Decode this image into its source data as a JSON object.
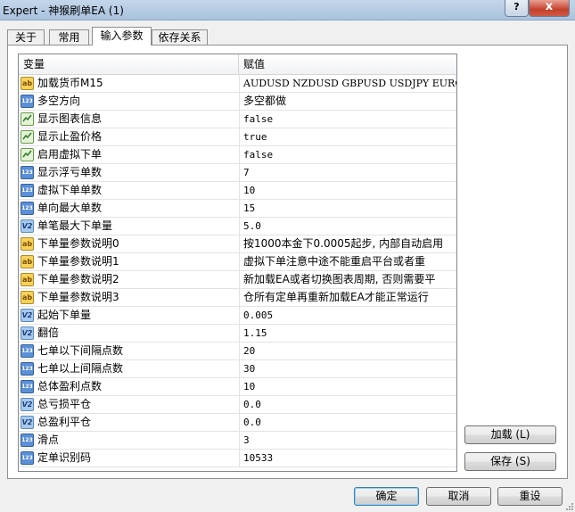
{
  "window": {
    "title": "Expert - 神猴刷单EA (1)",
    "help_label": "?",
    "close_label": "x"
  },
  "tabs": [
    {
      "label": "关于",
      "active": false
    },
    {
      "label": "常用",
      "active": false
    },
    {
      "label": "输入参数",
      "active": true
    },
    {
      "label": "依存关系",
      "active": false
    }
  ],
  "grid": {
    "columns": [
      "变量",
      "赋值"
    ],
    "rows": [
      {
        "type": "ab",
        "icon_name": "string-type-icon",
        "name": "加载货币M15",
        "value": "AUDUSD NZDUSD GBPUSD USDJPY EURGBP G..."
      },
      {
        "type": "123",
        "icon_name": "integer-type-icon",
        "name": "多空方向",
        "value": "多空都做"
      },
      {
        "type": "bool",
        "icon_name": "bool-type-icon",
        "name": "显示图表信息",
        "value": "false"
      },
      {
        "type": "bool",
        "icon_name": "bool-type-icon",
        "name": "显示止盈价格",
        "value": "true"
      },
      {
        "type": "bool",
        "icon_name": "bool-type-icon",
        "name": "启用虚拟下单",
        "value": "false"
      },
      {
        "type": "123",
        "icon_name": "integer-type-icon",
        "name": "显示浮亏单数",
        "value": "7"
      },
      {
        "type": "123",
        "icon_name": "integer-type-icon",
        "name": "虚拟下单单数",
        "value": "10"
      },
      {
        "type": "123",
        "icon_name": "integer-type-icon",
        "name": "单向最大单数",
        "value": "15"
      },
      {
        "type": "v2",
        "icon_name": "double-type-icon",
        "name": "单笔最大下单量",
        "value": "5.0"
      },
      {
        "type": "ab",
        "icon_name": "string-type-icon",
        "name": "下单量参数说明0",
        "value": "按1000本金下0.0005起步, 内部自动启用"
      },
      {
        "type": "ab",
        "icon_name": "string-type-icon",
        "name": "下单量参数说明1",
        "value": "虚拟下单注意中途不能重启平台或者重"
      },
      {
        "type": "ab",
        "icon_name": "string-type-icon",
        "name": "下单量参数说明2",
        "value": "新加载EA或者切换图表周期, 否则需要平"
      },
      {
        "type": "ab",
        "icon_name": "string-type-icon",
        "name": "下单量参数说明3",
        "value": "仓所有定单再重新加载EA才能正常运行"
      },
      {
        "type": "v2",
        "icon_name": "double-type-icon",
        "name": "起始下单量",
        "value": "0.005"
      },
      {
        "type": "v2",
        "icon_name": "double-type-icon",
        "name": "翻倍",
        "value": "1.15"
      },
      {
        "type": "123",
        "icon_name": "integer-type-icon",
        "name": "七单以下间隔点数",
        "value": "20"
      },
      {
        "type": "123",
        "icon_name": "integer-type-icon",
        "name": "七单以上间隔点数",
        "value": "30"
      },
      {
        "type": "123",
        "icon_name": "integer-type-icon",
        "name": "总体盈利点数",
        "value": "10"
      },
      {
        "type": "v2",
        "icon_name": "double-type-icon",
        "name": "总亏损平仓",
        "value": "0.0"
      },
      {
        "type": "v2",
        "icon_name": "double-type-icon",
        "name": "总盈利平仓",
        "value": "0.0"
      },
      {
        "type": "123",
        "icon_name": "integer-type-icon",
        "name": "滑点",
        "value": "3"
      },
      {
        "type": "123",
        "icon_name": "integer-type-icon",
        "name": "定单识别码",
        "value": "10533"
      }
    ]
  },
  "side_buttons": {
    "load": "加载 (L)",
    "save": "保存 (S)"
  },
  "footer_buttons": {
    "ok": "确定",
    "cancel": "取消",
    "reset": "重设"
  }
}
